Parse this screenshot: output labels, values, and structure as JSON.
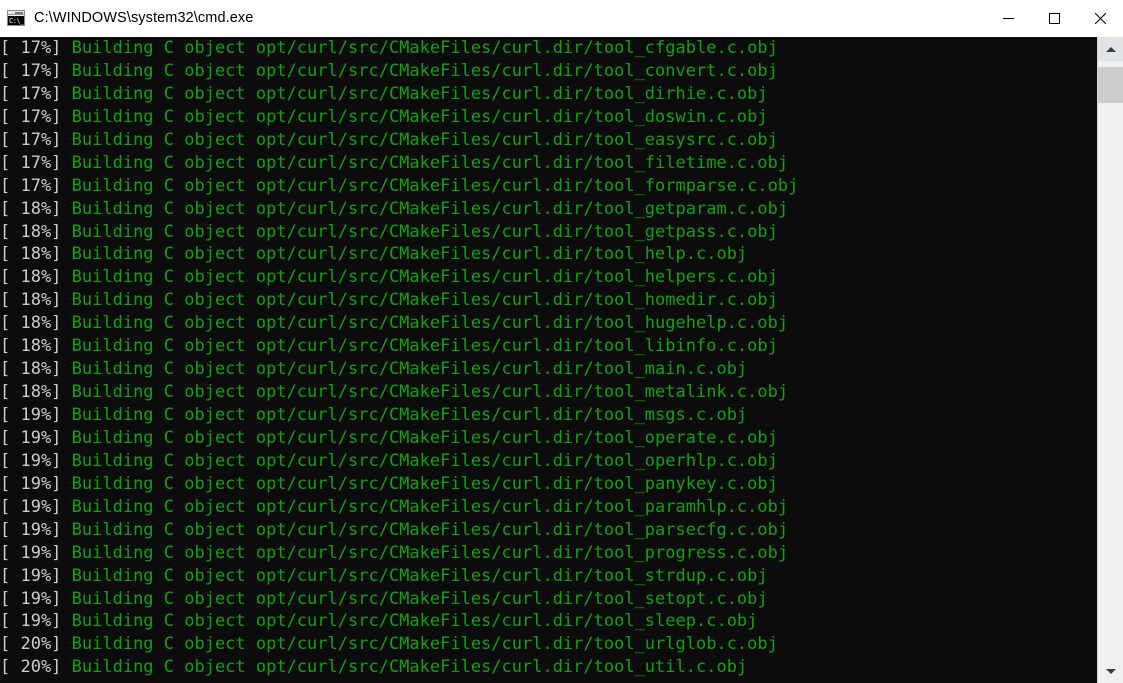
{
  "window": {
    "title": "C:\\WINDOWS\\system32\\cmd.exe",
    "icon_text": "C:\\_",
    "background": "#0c0c0c",
    "titlebar_background": "#ffffff"
  },
  "controls": {
    "minimize_label": "Minimize",
    "maximize_label": "Maximize",
    "close_label": "Close"
  },
  "console": {
    "text_color": "#13a10e",
    "prefix_color": "#cccccc",
    "font_size": "17px",
    "lines": [
      {
        "pct": "[ 17%]",
        "msg": " Building C object opt/curl/src/CMakeFiles/curl.dir/tool_cfgable.c.obj"
      },
      {
        "pct": "[ 17%]",
        "msg": " Building C object opt/curl/src/CMakeFiles/curl.dir/tool_convert.c.obj"
      },
      {
        "pct": "[ 17%]",
        "msg": " Building C object opt/curl/src/CMakeFiles/curl.dir/tool_dirhie.c.obj"
      },
      {
        "pct": "[ 17%]",
        "msg": " Building C object opt/curl/src/CMakeFiles/curl.dir/tool_doswin.c.obj"
      },
      {
        "pct": "[ 17%]",
        "msg": " Building C object opt/curl/src/CMakeFiles/curl.dir/tool_easysrc.c.obj"
      },
      {
        "pct": "[ 17%]",
        "msg": " Building C object opt/curl/src/CMakeFiles/curl.dir/tool_filetime.c.obj"
      },
      {
        "pct": "[ 17%]",
        "msg": " Building C object opt/curl/src/CMakeFiles/curl.dir/tool_formparse.c.obj"
      },
      {
        "pct": "[ 18%]",
        "msg": " Building C object opt/curl/src/CMakeFiles/curl.dir/tool_getparam.c.obj"
      },
      {
        "pct": "[ 18%]",
        "msg": " Building C object opt/curl/src/CMakeFiles/curl.dir/tool_getpass.c.obj"
      },
      {
        "pct": "[ 18%]",
        "msg": " Building C object opt/curl/src/CMakeFiles/curl.dir/tool_help.c.obj"
      },
      {
        "pct": "[ 18%]",
        "msg": " Building C object opt/curl/src/CMakeFiles/curl.dir/tool_helpers.c.obj"
      },
      {
        "pct": "[ 18%]",
        "msg": " Building C object opt/curl/src/CMakeFiles/curl.dir/tool_homedir.c.obj"
      },
      {
        "pct": "[ 18%]",
        "msg": " Building C object opt/curl/src/CMakeFiles/curl.dir/tool_hugehelp.c.obj"
      },
      {
        "pct": "[ 18%]",
        "msg": " Building C object opt/curl/src/CMakeFiles/curl.dir/tool_libinfo.c.obj"
      },
      {
        "pct": "[ 18%]",
        "msg": " Building C object opt/curl/src/CMakeFiles/curl.dir/tool_main.c.obj"
      },
      {
        "pct": "[ 18%]",
        "msg": " Building C object opt/curl/src/CMakeFiles/curl.dir/tool_metalink.c.obj"
      },
      {
        "pct": "[ 19%]",
        "msg": " Building C object opt/curl/src/CMakeFiles/curl.dir/tool_msgs.c.obj"
      },
      {
        "pct": "[ 19%]",
        "msg": " Building C object opt/curl/src/CMakeFiles/curl.dir/tool_operate.c.obj"
      },
      {
        "pct": "[ 19%]",
        "msg": " Building C object opt/curl/src/CMakeFiles/curl.dir/tool_operhlp.c.obj"
      },
      {
        "pct": "[ 19%]",
        "msg": " Building C object opt/curl/src/CMakeFiles/curl.dir/tool_panykey.c.obj"
      },
      {
        "pct": "[ 19%]",
        "msg": " Building C object opt/curl/src/CMakeFiles/curl.dir/tool_paramhlp.c.obj"
      },
      {
        "pct": "[ 19%]",
        "msg": " Building C object opt/curl/src/CMakeFiles/curl.dir/tool_parsecfg.c.obj"
      },
      {
        "pct": "[ 19%]",
        "msg": " Building C object opt/curl/src/CMakeFiles/curl.dir/tool_progress.c.obj"
      },
      {
        "pct": "[ 19%]",
        "msg": " Building C object opt/curl/src/CMakeFiles/curl.dir/tool_strdup.c.obj"
      },
      {
        "pct": "[ 19%]",
        "msg": " Building C object opt/curl/src/CMakeFiles/curl.dir/tool_setopt.c.obj"
      },
      {
        "pct": "[ 19%]",
        "msg": " Building C object opt/curl/src/CMakeFiles/curl.dir/tool_sleep.c.obj"
      },
      {
        "pct": "[ 20%]",
        "msg": " Building C object opt/curl/src/CMakeFiles/curl.dir/tool_urlglob.c.obj"
      },
      {
        "pct": "[ 20%]",
        "msg": " Building C object opt/curl/src/CMakeFiles/curl.dir/tool_util.c.obj"
      }
    ]
  },
  "scrollbar": {
    "up_label": "Scroll up",
    "down_label": "Scroll down",
    "thumb_label": "Scroll thumb"
  }
}
